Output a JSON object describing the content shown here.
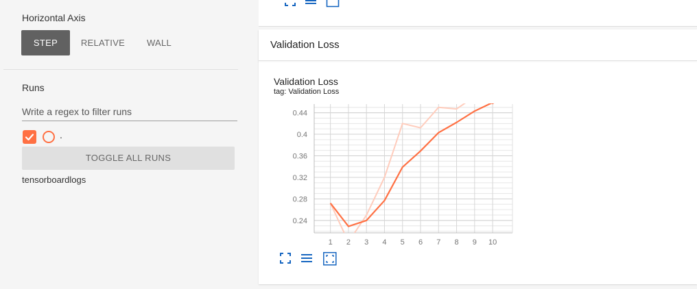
{
  "sidebar": {
    "horizontal_axis": {
      "title": "Horizontal Axis",
      "options": [
        "STEP",
        "RELATIVE",
        "WALL"
      ],
      "selected": "STEP"
    },
    "runs": {
      "title": "Runs",
      "filter_placeholder": "Write a regex to filter runs",
      "run_label": ".",
      "run_checked": true,
      "toggle_label": "TOGGLE ALL RUNS",
      "logdir": "tensorboardlogs"
    }
  },
  "main": {
    "card_title": "Validation Loss",
    "chart": {
      "title": "Validation Loss",
      "tag": "tag: Validation Loss"
    }
  },
  "colors": {
    "accent": "#ff7043",
    "selected_button": "#616161",
    "icon_blue": "#1565c0"
  },
  "icons": [
    "expand-icon",
    "lines-icon",
    "fit-domain-icon"
  ],
  "chart_data": {
    "type": "line",
    "x": [
      1,
      2,
      3,
      4,
      5,
      6,
      7,
      8,
      9,
      10
    ],
    "x_ticks": [
      "1",
      "2",
      "3",
      "4",
      "5",
      "6",
      "7",
      "8",
      "9",
      "10"
    ],
    "y_ticks": [
      "0.24",
      "0.28",
      "0.32",
      "0.36",
      "0.4",
      "0.44"
    ],
    "ylim": [
      0.217,
      0.456
    ],
    "xlim": [
      0.1,
      11.1
    ],
    "grid": true,
    "series": [
      {
        "role": "smoothed",
        "color": "#ff7043",
        "values": [
          0.272,
          0.229,
          0.24,
          0.277,
          0.339,
          0.369,
          0.403,
          0.422,
          0.443,
          0.459
        ]
      },
      {
        "role": "raw",
        "color": "#ffccbc",
        "values": [
          0.272,
          0.2,
          0.25,
          0.32,
          0.42,
          0.412,
          0.45,
          0.447,
          0.47,
          0.47
        ]
      }
    ]
  }
}
